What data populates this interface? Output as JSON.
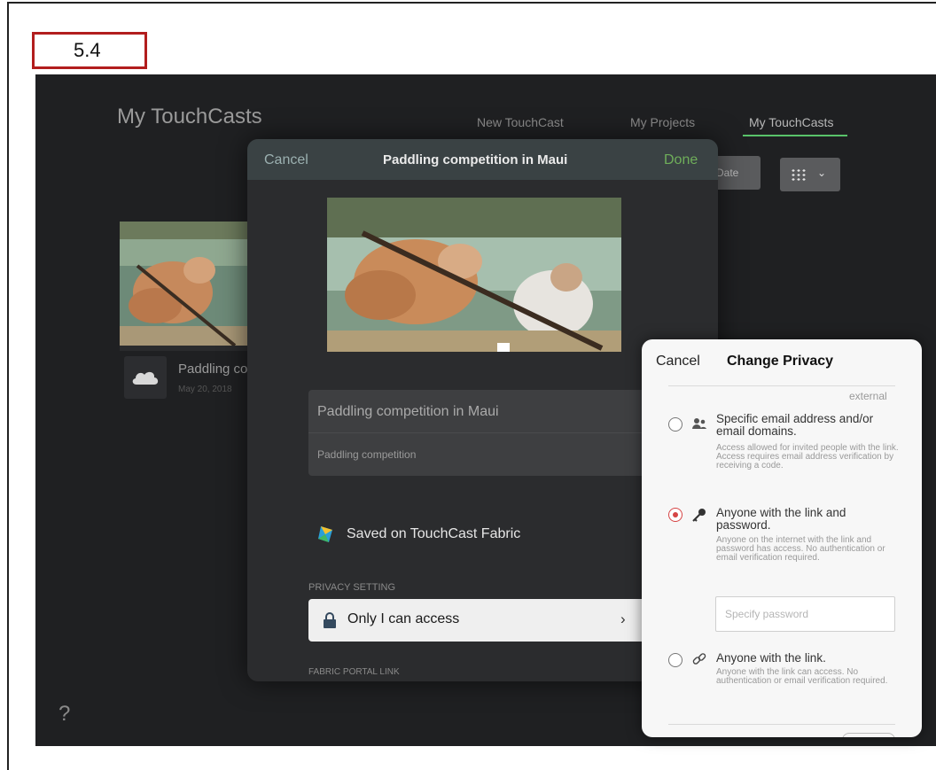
{
  "step_badge": "5.4",
  "app": {
    "title": "My TouchCasts",
    "nav": {
      "new_touchcast": "New TouchCast",
      "my_projects": "My Projects",
      "my_touchcasts": "My TouchCasts"
    },
    "sort_button": "Date",
    "card": {
      "title": "Paddling co",
      "date": "May 20, 2018"
    },
    "help": "?"
  },
  "modal": {
    "cancel": "Cancel",
    "title": "Paddling competition in Maui",
    "done": "Done",
    "field_title": "Paddling competition in Maui",
    "field_description": "Paddling competition",
    "saved_on": "Saved on TouchCast Fabric",
    "privacy_setting_label": "PRIVACY SETTING",
    "access_value": "Only I can access",
    "fabric_portal_label": "FABRIC PORTAL LINK"
  },
  "privacy_popup": {
    "cancel": "Cancel",
    "title": "Change Privacy",
    "section_hint": "external",
    "selected_option": "link_and_password",
    "options": [
      {
        "id": "email",
        "icon": "users-icon",
        "title": "Specific email address and/or email domains.",
        "description": "Access allowed for invited people with the link. Access requires email address verification by receiving a code."
      },
      {
        "id": "link_and_password",
        "icon": "key-icon",
        "title": "Anyone with the link and password.",
        "description": "Anyone on the internet with the link and password has access. No authentication or email verification required."
      },
      {
        "id": "link",
        "icon": "link-icon",
        "title": "Anyone with the link.",
        "description": "Anyone with the link can access. No authentication or email verification required."
      }
    ],
    "password_placeholder": "Specify password"
  },
  "colors": {
    "app_background": "#1f2022",
    "modal_header": "#3a4244",
    "done_green": "#6fae5a",
    "nav_accent": "#59c26a",
    "radio_selected": "#d64545"
  }
}
